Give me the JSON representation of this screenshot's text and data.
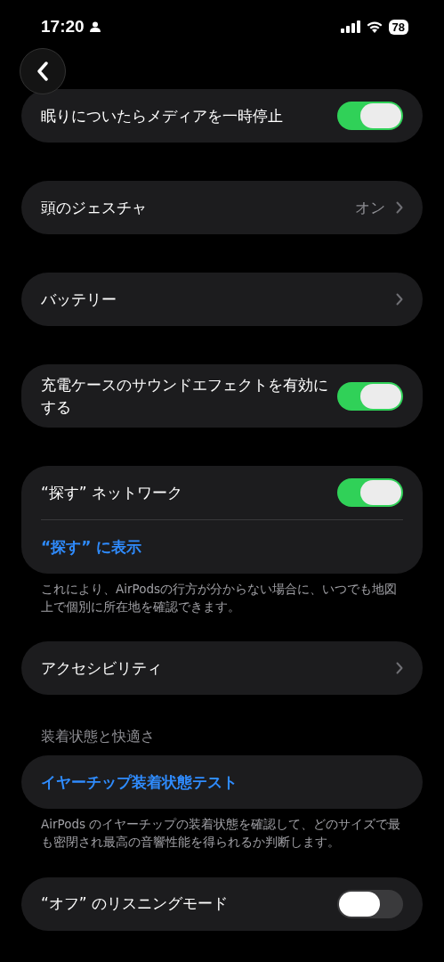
{
  "status_bar": {
    "time": "17:20",
    "battery": "78"
  },
  "sections": [
    {
      "rows": [
        {
          "kind": "toggle",
          "label": "眠りについたらメディアを一時停止",
          "on": true
        }
      ]
    },
    {
      "rows": [
        {
          "kind": "nav",
          "label": "頭のジェスチャ",
          "value": "オン"
        }
      ]
    },
    {
      "rows": [
        {
          "kind": "nav",
          "label": "バッテリー"
        }
      ]
    },
    {
      "rows": [
        {
          "kind": "toggle",
          "label": "充電ケースのサウンドエフェクトを有効にする",
          "on": true
        }
      ]
    },
    {
      "rows": [
        {
          "kind": "toggle",
          "label": "“探す” ネットワーク",
          "on": true
        },
        {
          "kind": "link",
          "label": "“探す” に表示"
        }
      ],
      "footer": "これにより、AirPodsの行方が分からない場合に、いつでも地図上で個別に所在地を確認できます。"
    },
    {
      "rows": [
        {
          "kind": "nav",
          "label": "アクセシビリティ"
        }
      ]
    },
    {
      "header": "装着状態と快適さ",
      "rows": [
        {
          "kind": "link",
          "label": "イヤーチップ装着状態テスト"
        }
      ],
      "footer": "AirPods のイヤーチップの装着状態を確認して、どのサイズで最も密閉され最高の音響性能を得られるか判断します。"
    },
    {
      "rows": [
        {
          "kind": "toggle",
          "label": "“オフ” のリスニングモード",
          "on": false
        }
      ]
    }
  ]
}
